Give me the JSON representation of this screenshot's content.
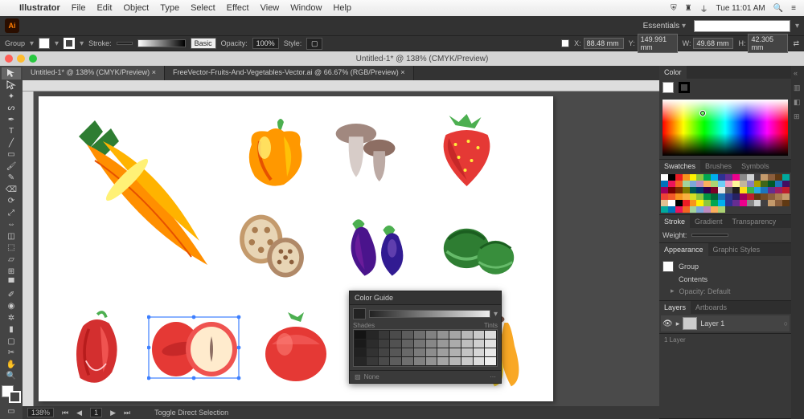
{
  "menubar": {
    "app_name": "Illustrator",
    "items": [
      "File",
      "Edit",
      "Object",
      "Type",
      "Select",
      "Effect",
      "View",
      "Window",
      "Help"
    ],
    "clock": "Tue 11:01 AM"
  },
  "workspace": {
    "name": "Essentials"
  },
  "control": {
    "sel_type": "Group",
    "stroke_label": "Stroke:",
    "stroke_pt": "",
    "style_label": "Style:",
    "basic": "Basic",
    "opacity_label": "Opacity:",
    "opacity": "100%",
    "x_label": "X:",
    "x": "88.48 mm",
    "y_label": "Y:",
    "y": "149.991 mm",
    "w_label": "W:",
    "w": "49.68 mm",
    "h_label": "H:",
    "h": "42.305 mm"
  },
  "doc": {
    "title": "Untitled-1* @ 138% (CMYK/Preview)",
    "tabs": [
      {
        "label": "Untitled-1* @ 138% (CMYK/Preview)",
        "active": true
      },
      {
        "label": "FreeVector-Fruits-And-Vegetables-Vector.ai @ 66.67% (RGB/Preview)",
        "active": false
      }
    ]
  },
  "color_guide": {
    "title": "Color Guide",
    "shades": "Shades",
    "tints": "Tints",
    "none": "None"
  },
  "panels": {
    "color": "Color",
    "swatches": "Swatches",
    "brushes": "Brushes",
    "symbols": "Symbols",
    "stroke": "Stroke",
    "gradient": "Gradient",
    "transparency": "Transparency",
    "weight": "Weight:",
    "appearance": "Appearance",
    "graphic_styles": "Graphic Styles",
    "group": "Group",
    "contents": "Contents",
    "opacity_default": "Opacity: Default",
    "layers": "Layers",
    "artboards": "Artboards",
    "layer1": "Layer 1",
    "layer_count": "1 Layer"
  },
  "status": {
    "zoom": "138%",
    "hint": "Toggle Direct Selection"
  },
  "swatch_colors": [
    "#fff",
    "#000",
    "#ec1c24",
    "#f7941d",
    "#fff200",
    "#8dc63f",
    "#00a651",
    "#00aeef",
    "#2e3192",
    "#662d91",
    "#ec008c",
    "#898989",
    "#d1d3d4",
    "#414042",
    "#c49a6c",
    "#8b5e3c",
    "#603913",
    "#00a99d",
    "#0072bc",
    "#ed145b",
    "#f26522",
    "#a3d39c",
    "#7da7d9",
    "#bd8cbf",
    "#fbaf5d",
    "#acd373",
    "#6dcff6",
    "#f49ac1",
    "#fff799",
    "#c2b59b",
    "#8781bd",
    "#aba000",
    "#406618",
    "#005826",
    "#1b75bb",
    "#440e62",
    "#9e005d",
    "#790000",
    "#7b2e00",
    "#827b00",
    "#005952",
    "#003471",
    "#32004b",
    "#7a0026",
    "#e6e7e8",
    "#58595b",
    "#231f20",
    "#ffde17",
    "#39b54a",
    "#27aae1",
    "#1c75bc",
    "#652d90",
    "#9e1f63",
    "#be1e2d",
    "#ef4136",
    "#f15a29",
    "#f7941e",
    "#fbb040",
    "#d7df23",
    "#8dc63f",
    "#009444",
    "#006838",
    "#1b75bb",
    "#2b3990",
    "#262262",
    "#9e005d",
    "#be1e2d",
    "#603913",
    "#754c24",
    "#8b5e3c",
    "#a97c50",
    "#c49a6c",
    "#e0c092",
    "#fff",
    "#000",
    "#ec1c24",
    "#f7941d",
    "#fff200",
    "#8dc63f",
    "#00a651",
    "#00aeef",
    "#2e3192",
    "#662d91",
    "#ec008c",
    "#898989",
    "#d1d3d4",
    "#414042",
    "#c49a6c",
    "#8b5e3c",
    "#603913",
    "#00a99d",
    "#0072bc",
    "#ed145b",
    "#f26522",
    "#a3d39c",
    "#7da7d9",
    "#bd8cbf",
    "#fbaf5d",
    "#acd373"
  ],
  "artboard_items": [
    "carrots",
    "bell-pepper",
    "mushrooms",
    "strawberry",
    "lotus-root",
    "eggplant",
    "watermelon",
    "pepper",
    "apple-cut",
    "tomato",
    "pumpkin",
    "bananas"
  ]
}
